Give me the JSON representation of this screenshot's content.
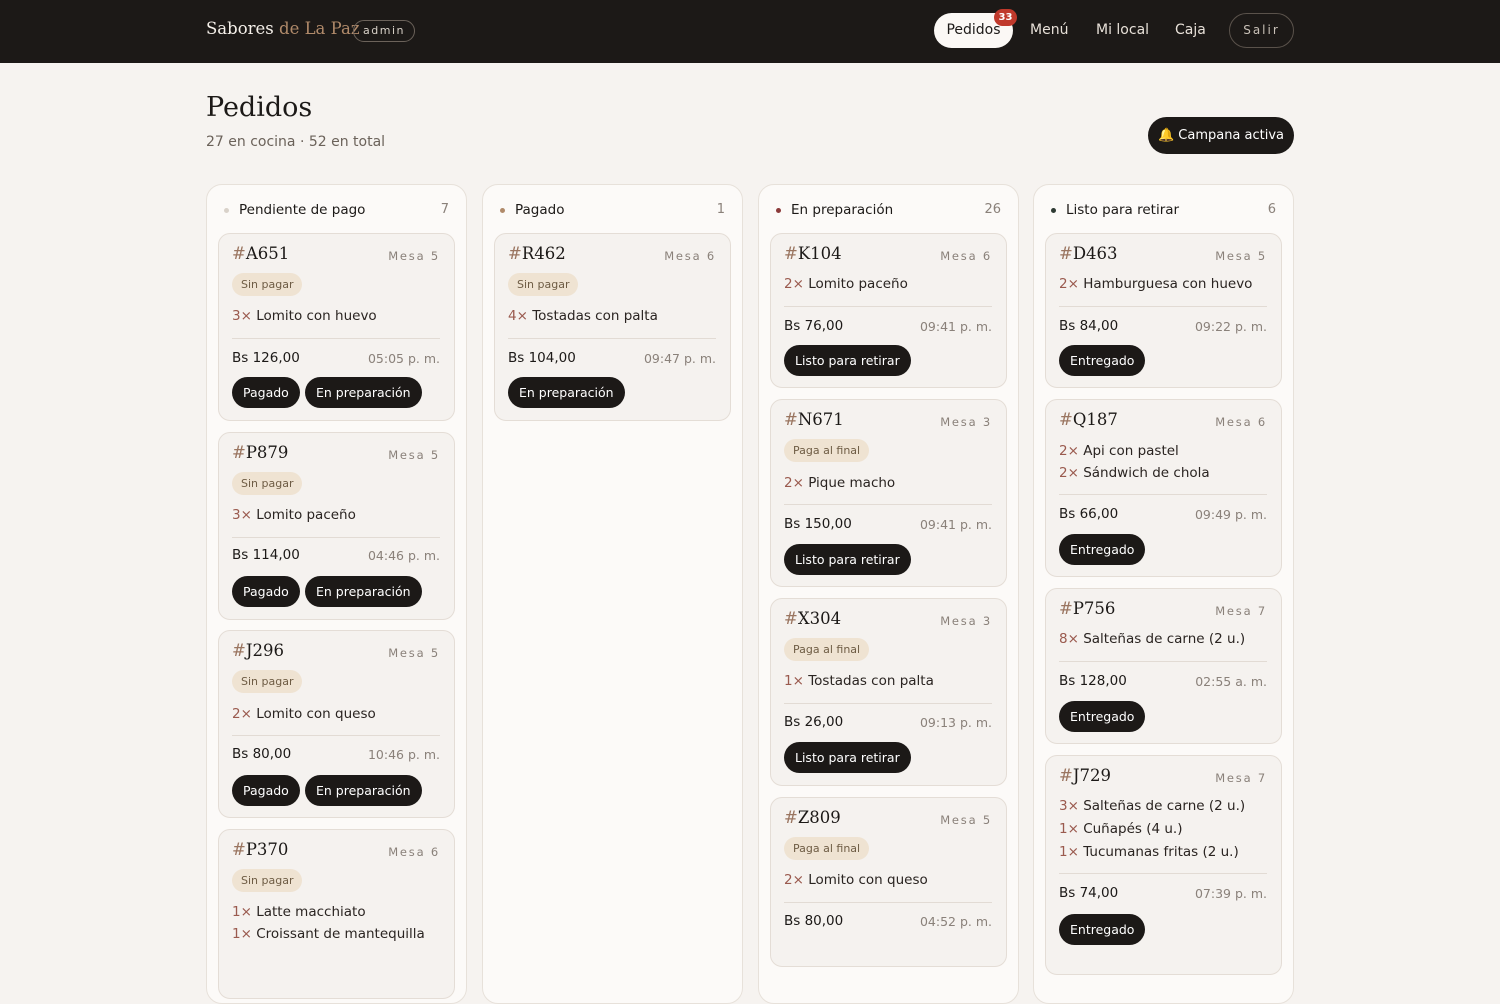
{
  "app": {
    "brand_main": "Sabores",
    "brand_accent": "de La Paz",
    "role_badge": "admin"
  },
  "nav": {
    "active": "Pedidos",
    "active_badge": "33",
    "links": [
      "Menú",
      "Mi local",
      "Caja"
    ],
    "logout": "Salir"
  },
  "page": {
    "title": "Pedidos",
    "subtitle": "27 en cocina · 52 en total",
    "campaign_button": "🔔 Campana activa"
  },
  "colors": {
    "pendiente": "#d9d2ca",
    "pagado": "#b08a6a",
    "preparacion": "#8b3a3a",
    "listo": "#2e3a33"
  },
  "columns": [
    {
      "name": "Pendiente de pago",
      "count": "7",
      "cards": [
        {
          "hash": "#",
          "code": "A651",
          "table": "Mesa 5",
          "badge": "Sin pagar",
          "items": [
            {
              "qty": "3×",
              "name": "Lomito con huevo"
            }
          ],
          "price": "Bs 126,00",
          "time": "05:05 p. m.",
          "actions": [
            "Pagado",
            "En preparación"
          ]
        },
        {
          "hash": "#",
          "code": "P879",
          "table": "Mesa 5",
          "badge": "Sin pagar",
          "items": [
            {
              "qty": "3×",
              "name": "Lomito paceño"
            }
          ],
          "price": "Bs 114,00",
          "time": "04:46 p. m.",
          "actions": [
            "Pagado",
            "En preparación"
          ]
        },
        {
          "hash": "#",
          "code": "J296",
          "table": "Mesa 5",
          "badge": "Sin pagar",
          "items": [
            {
              "qty": "2×",
              "name": "Lomito con queso"
            }
          ],
          "price": "Bs 80,00",
          "time": "10:46 p. m.",
          "actions": [
            "Pagado",
            "En preparación"
          ]
        },
        {
          "hash": "#",
          "code": "P370",
          "table": "Mesa 6",
          "badge": "Sin pagar",
          "items": [
            {
              "qty": "1×",
              "name": "Latte macchiato"
            },
            {
              "qty": "1×",
              "name": "Croissant de mantequilla"
            }
          ]
        }
      ]
    },
    {
      "name": "Pagado",
      "count": "1",
      "cards": [
        {
          "hash": "#",
          "code": "R462",
          "table": "Mesa 6",
          "badge": "Sin pagar",
          "items": [
            {
              "qty": "4×",
              "name": "Tostadas con palta"
            }
          ],
          "price": "Bs 104,00",
          "time": "09:47 p. m.",
          "actions": [
            "En preparación"
          ]
        }
      ]
    },
    {
      "name": "En preparación",
      "count": "26",
      "cards": [
        {
          "hash": "#",
          "code": "K104",
          "table": "Mesa 6",
          "items": [
            {
              "qty": "2×",
              "name": "Lomito paceño"
            }
          ],
          "price": "Bs 76,00",
          "time": "09:41 p. m.",
          "actions": [
            "Listo para retirar"
          ]
        },
        {
          "hash": "#",
          "code": "N671",
          "table": "Mesa 3",
          "badge": "Paga al final",
          "items": [
            {
              "qty": "2×",
              "name": "Pique macho"
            }
          ],
          "price": "Bs 150,00",
          "time": "09:41 p. m.",
          "actions": [
            "Listo para retirar"
          ]
        },
        {
          "hash": "#",
          "code": "X304",
          "table": "Mesa 3",
          "badge": "Paga al final",
          "items": [
            {
              "qty": "1×",
              "name": "Tostadas con palta"
            }
          ],
          "price": "Bs 26,00",
          "time": "09:13 p. m.",
          "actions": [
            "Listo para retirar"
          ]
        },
        {
          "hash": "#",
          "code": "Z809",
          "table": "Mesa 5",
          "badge": "Paga al final",
          "items": [
            {
              "qty": "2×",
              "name": "Lomito con queso"
            }
          ],
          "price": "Bs 80,00",
          "time": "04:52 p. m."
        }
      ]
    },
    {
      "name": "Listo para retirar",
      "count": "6",
      "cards": [
        {
          "hash": "#",
          "code": "D463",
          "table": "Mesa 5",
          "items": [
            {
              "qty": "2×",
              "name": "Hamburguesa con huevo"
            }
          ],
          "price": "Bs 84,00",
          "time": "09:22 p. m.",
          "actions": [
            "Entregado"
          ]
        },
        {
          "hash": "#",
          "code": "Q187",
          "table": "Mesa 6",
          "items": [
            {
              "qty": "2×",
              "name": "Api con pastel"
            },
            {
              "qty": "2×",
              "name": "Sándwich de chola"
            }
          ],
          "price": "Bs 66,00",
          "time": "09:49 p. m.",
          "actions": [
            "Entregado"
          ]
        },
        {
          "hash": "#",
          "code": "P756",
          "table": "Mesa 7",
          "items": [
            {
              "qty": "8×",
              "name": "Salteñas de carne (2 u.)"
            }
          ],
          "price": "Bs 128,00",
          "time": "02:55 a. m.",
          "actions": [
            "Entregado"
          ]
        },
        {
          "hash": "#",
          "code": "J729",
          "table": "Mesa 7",
          "items": [
            {
              "qty": "3×",
              "name": "Salteñas de carne (2 u.)"
            },
            {
              "qty": "1×",
              "name": "Cuñapés (4 u.)"
            },
            {
              "qty": "1×",
              "name": "Tucumanas fritas (2 u.)"
            }
          ],
          "price": "Bs 74,00",
          "time": "07:39 p. m.",
          "actions": [
            "Entregado"
          ]
        }
      ]
    }
  ]
}
